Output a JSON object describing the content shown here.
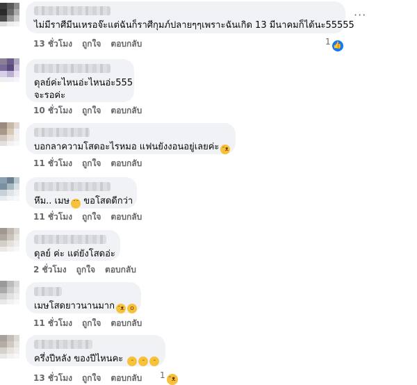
{
  "actions": {
    "like": "ถูกใจ",
    "reply": "ตอบกลับ"
  },
  "more_label": "···",
  "comments": [
    {
      "text_lines": [
        "ไม่มีราศีมีนเหรอจ๊ะแต่ฉันก็ราศีกุมภ์ปลายๆๆเพราะฉันเกิด 13 มีนาคมก็ได้นะ55555"
      ],
      "time": "13 ชั่วโมง",
      "reaction_count": "1",
      "reaction_icon": "like-icon",
      "reaction_color": "#1877f2"
    },
    {
      "text_lines": [
        "ดุลย์ค่ะไหนอ่ะไหนอ่ะ555",
        "จะรอค่ะ"
      ],
      "time": "10 ชั่วโมง"
    },
    {
      "text_lines": [
        "บอกลาความโสดอะไรหมอ แฟนยังงอนอยู่เลยค่ะ"
      ],
      "emoji": [
        "laughing-emoji"
      ],
      "time": "11 ชั่วโมง"
    },
    {
      "text_lines": [
        "หึม.. เมษ",
        " ขอโสดดีกว่า"
      ],
      "emoji": [
        "thinking-emoji"
      ],
      "time": "11 ชั่วโมง"
    },
    {
      "text_lines": [
        "ดุลย์ ค่ะ แต่ยังโสดอ่ะ"
      ],
      "time": "2 ชั่วโมง"
    },
    {
      "text_lines": [
        "เมษโสดยาวนานมาก"
      ],
      "emoji": [
        "rofl-emoji",
        "hushed-emoji"
      ],
      "time": "11 ชั่วโมง"
    },
    {
      "text_lines": [
        "ครึ่งปีหลัง ของปีไหนคะ "
      ],
      "emoji": [
        "grin-emoji",
        "grin-emoji",
        "grin-emoji"
      ],
      "time": "13 ชั่วโมง",
      "reaction_count": "1",
      "reaction_icon": "haha-icon",
      "reaction_color": "#f7c23b"
    }
  ]
}
